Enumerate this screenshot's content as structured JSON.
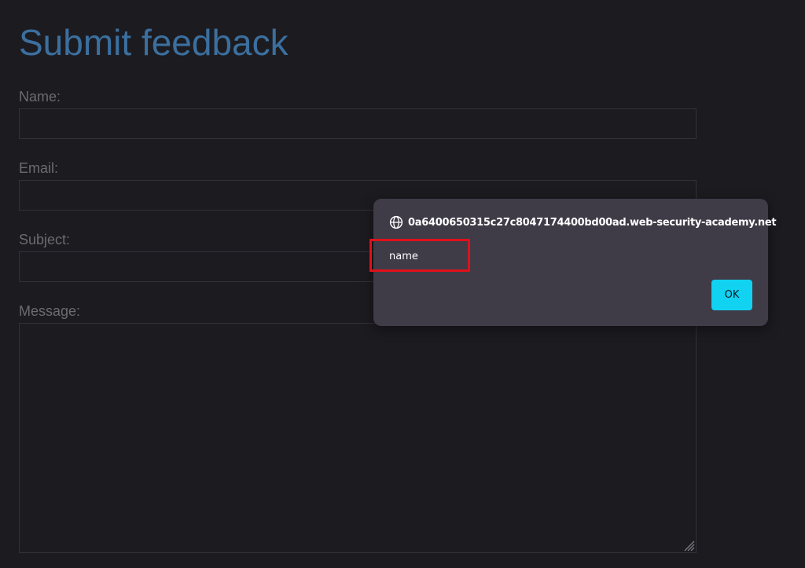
{
  "page": {
    "title": "Submit feedback"
  },
  "form": {
    "name_label": "Name:",
    "name_value": "",
    "email_label": "Email:",
    "email_value": "",
    "subject_label": "Subject:",
    "subject_value": "",
    "message_label": "Message:",
    "message_value": ""
  },
  "alert": {
    "origin": "0a6400650315c27c8047174400bd00ad.web-security-academy.net",
    "message": "name",
    "ok_label": "OK",
    "origin_icon": "globe-icon"
  },
  "colors": {
    "background": "#1c1b20",
    "title": "#3b6f9e",
    "label": "#6b6b70",
    "dialog": "#3f3c48",
    "ok_button": "#12d2f2",
    "highlight": "#e0101a"
  }
}
